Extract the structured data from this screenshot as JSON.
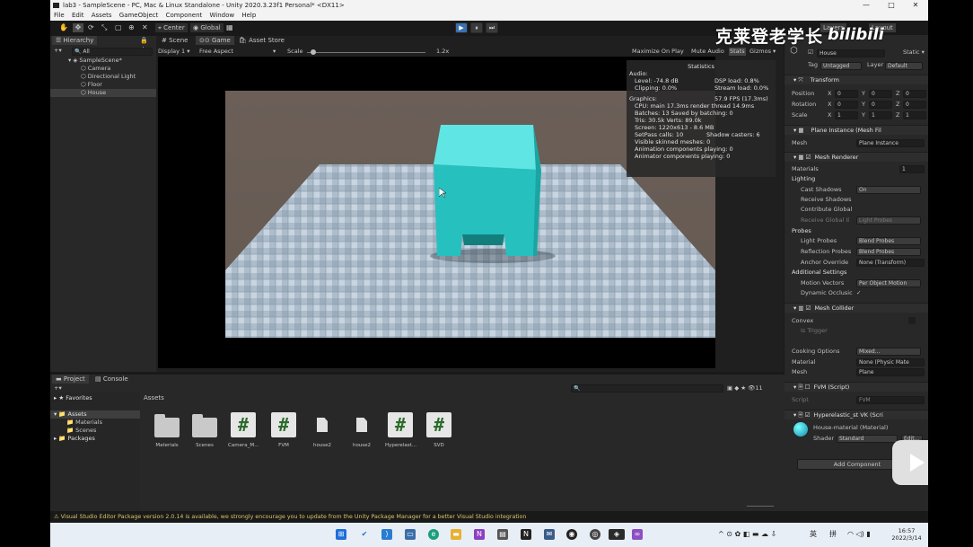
{
  "window": {
    "title": "lab3 - SampleScene - PC, Mac & Linux Standalone - Unity 2020.3.23f1 Personal* <DX11>",
    "minimize": "—",
    "maximize": "□",
    "close": "✕"
  },
  "menu": [
    "File",
    "Edit",
    "Assets",
    "GameObject",
    "Component",
    "Window",
    "Help"
  ],
  "toolbar": {
    "center": "Center",
    "global": "Global",
    "play": "▶",
    "pause": "⏸",
    "step": "⏭",
    "layers": "Layers",
    "layout": "Layout"
  },
  "hierarchy": {
    "tab": "Hierarchy",
    "search": "All",
    "scene": "SampleScene*",
    "items": [
      "Camera",
      "Directional Light",
      "Floor",
      "House"
    ]
  },
  "view_tabs": [
    "Scene",
    "Game",
    "Asset Store"
  ],
  "game_bar": {
    "display": "Display 1",
    "aspect": "Free Aspect",
    "scale_label": "Scale",
    "scale_value": "1.2x",
    "maximize": "Maximize On Play",
    "mute": "Mute Audio",
    "stats": "Stats",
    "gizmos": "Gizmos"
  },
  "stats": {
    "title": "Statistics",
    "audio_label": "Audio:",
    "level": "Level: -74.8 dB",
    "dsp": "DSP load: 0.8%",
    "clipping": "Clipping: 0.0%",
    "stream": "Stream load: 0.0%",
    "graphics_label": "Graphics:",
    "fps": "57.9 FPS (17.3ms)",
    "cpu": "CPU: main 17.3ms  render thread 14.9ms",
    "batches": "Batches: 13    Saved by batching: 0",
    "tris": "Tris: 30.5k    Verts: 89.0k",
    "screen": "Screen: 1220x613 - 8.6 MB",
    "setpass": "SetPass calls: 10",
    "shadow": "Shadow casters: 6",
    "skinned": "Visible skinned meshes: 0",
    "anim": "Animation components playing: 0",
    "animator": "Animator components playing: 0"
  },
  "inspector": {
    "name": "House",
    "static": "Static",
    "tag_label": "Tag",
    "tag": "Untagged",
    "layer_label": "Layer",
    "layer": "Default",
    "transform": "Transform",
    "position_label": "Position",
    "rotation_label": "Rotation",
    "scale_label": "Scale",
    "position": [
      "0",
      "0",
      "0"
    ],
    "rotation": [
      "0",
      "0",
      "0"
    ],
    "scale": [
      "1",
      "1",
      "1"
    ],
    "mesh_filter": "Plane Instance (Mesh Fil",
    "mesh_label": "Mesh",
    "mesh_value": "Plane Instance",
    "mesh_renderer": "Mesh Renderer",
    "materials_label": "Materials",
    "materials_count": "1",
    "lighting_label": "Lighting",
    "cast_shadows_label": "Cast Shadows",
    "cast_shadows": "On",
    "receive_shadows_label": "Receive Shadows",
    "contribute_gi_label": "Contribute Global",
    "receive_gi_label": "Receive Global Il",
    "receive_gi": "Light Probes",
    "probes_label": "Probes",
    "light_probes_label": "Light Probes",
    "light_probes": "Blend Probes",
    "reflection_probes_label": "Reflection Probes",
    "reflection_probes": "Blend Probes",
    "anchor_label": "Anchor Override",
    "anchor": "None (Transform)",
    "additional_label": "Additional Settings",
    "motion_label": "Motion Vectors",
    "motion": "Per Object Motion",
    "occlusion_label": "Dynamic Occlusic",
    "occlusion_check": "✓",
    "mesh_collider": "Mesh Collider",
    "convex_label": "Convex",
    "trigger_label": "Is Trigger",
    "cooking_label": "Cooking Options",
    "cooking": "Mixed...",
    "material_label": "Material",
    "material": "None (Physic Mate",
    "collider_mesh_label": "Mesh",
    "collider_mesh": "Plane",
    "fvm_script": "FVM (Script)",
    "script_label": "Script",
    "script_value": "FVM",
    "hyper": "Hyperelastic_st VK (Scri",
    "house_material": "House-material (Material)",
    "shader_label": "Shader",
    "shader": "Standard",
    "edit": "Edit...",
    "add_component": "Add Component"
  },
  "project": {
    "tab": "Project",
    "console_tab": "Console",
    "favorites": "Favorites",
    "assets_root": "Assets",
    "tree": [
      "Materials",
      "Scenes"
    ],
    "packages": "Packages",
    "breadcrumb": "Assets",
    "count": "11",
    "items": [
      "Materials",
      "Scenes",
      "Camera_M...",
      "FVM",
      "house2",
      "house2",
      "Hyperelast...",
      "SVD"
    ]
  },
  "status": "Visual Studio Editor Package version 2.0.14 is available, we strongly encourage you to update from the Unity Package Manager for a better Visual Studio integration",
  "watermark": "克莱登老学长",
  "taskbar": {
    "time": "16:57",
    "date": "2022/3/14",
    "ime1": "英",
    "ime2": "拼"
  },
  "colors": {
    "accent": "#3a72b0",
    "house": "#2ec8c6",
    "editor_bg": "#282828"
  }
}
